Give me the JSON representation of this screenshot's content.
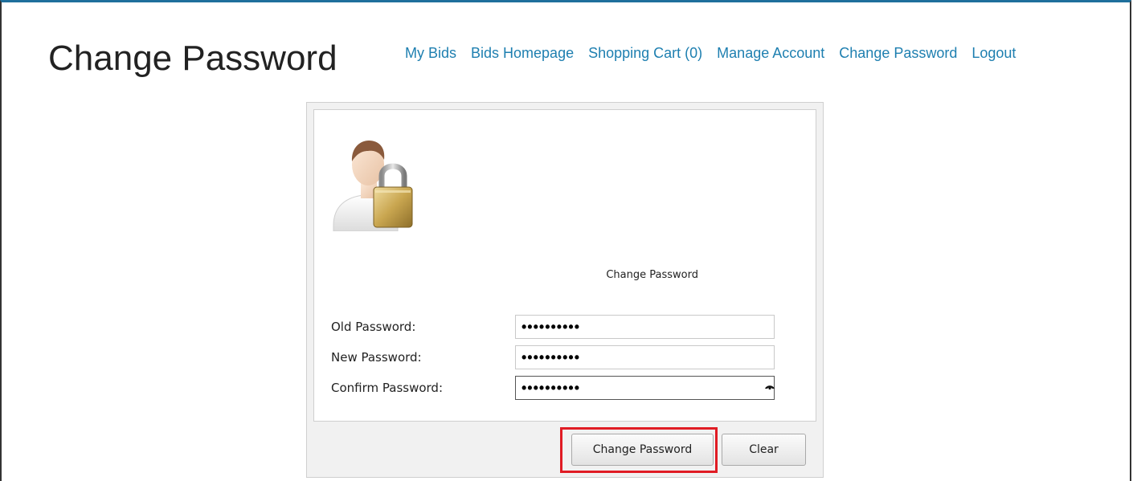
{
  "header": {
    "title": "Change Password",
    "nav": [
      "My Bids",
      "Bids Homepage",
      "Shopping Cart (0)",
      "Manage Account",
      "Change Password",
      "Logout"
    ]
  },
  "form": {
    "heading": "Change Password",
    "fields": [
      {
        "label": "Old Password:",
        "value": "••••••••••"
      },
      {
        "label": "New Password:",
        "value": "••••••••••"
      },
      {
        "label": "Confirm Password:",
        "value": "••••••••••"
      }
    ],
    "submit_label": "Change Password",
    "clear_label": "Clear"
  },
  "icons": {
    "user_lock": "user-lock-icon",
    "reveal": "eye-icon"
  },
  "colors": {
    "link": "#1e7fb0",
    "highlight": "#e01c24",
    "frame_top": "#1f6f9c"
  }
}
